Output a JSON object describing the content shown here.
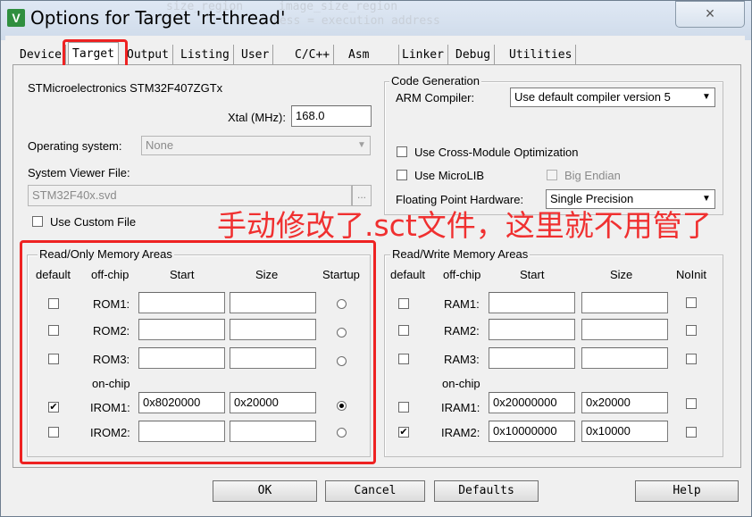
{
  "window": {
    "title": "Options for Target 'rt-thread'",
    "close_label": "×",
    "background_code": [
      "  size_region",
      "image_size_region",
      "ress = execution address"
    ]
  },
  "tabs": [
    "Device",
    "Target",
    "Output",
    "Listing",
    "User",
    "C/C++",
    "Asm",
    "Linker",
    "Debug",
    "Utilities"
  ],
  "active_tab": "Target",
  "target": {
    "device_name": "STMicroelectronics STM32F407ZGTx",
    "xtal_label": "Xtal (MHz):",
    "xtal_value": "168.0",
    "os_label": "Operating system:",
    "os_value": "None",
    "sysviewer_label": "System Viewer File:",
    "sysviewer_value": "STM32F40x.svd",
    "browse_label": "...",
    "custom_file_label": "Use Custom File"
  },
  "code_generation": {
    "title": "Code Generation",
    "compiler_label": "ARM Compiler:",
    "compiler_value": "Use default compiler version 5",
    "cross_module_label": "Use Cross-Module Optimization",
    "microlib_label": "Use MicroLIB",
    "big_endian_label": "Big Endian",
    "fpu_label": "Floating Point Hardware:",
    "fpu_value": "Single Precision"
  },
  "annotation": "手动修改了.sct文件，这里就不用管了",
  "rom": {
    "title": "Read/Only Memory Areas",
    "headers": {
      "default": "default",
      "offchip": "off-chip",
      "start": "Start",
      "size": "Size",
      "startup": "Startup"
    },
    "onchip_label": "on-chip",
    "rows": [
      {
        "name": "ROM1:",
        "start": "",
        "size": "",
        "default": false,
        "startup": false
      },
      {
        "name": "ROM2:",
        "start": "",
        "size": "",
        "default": false,
        "startup": false
      },
      {
        "name": "ROM3:",
        "start": "",
        "size": "",
        "default": false,
        "startup": false
      },
      {
        "name": "IROM1:",
        "start": "0x8020000",
        "size": "0x20000",
        "default": true,
        "startup": true
      },
      {
        "name": "IROM2:",
        "start": "",
        "size": "",
        "default": false,
        "startup": false
      }
    ]
  },
  "ram": {
    "title": "Read/Write Memory Areas",
    "headers": {
      "default": "default",
      "offchip": "off-chip",
      "start": "Start",
      "size": "Size",
      "noinit": "NoInit"
    },
    "onchip_label": "on-chip",
    "rows": [
      {
        "name": "RAM1:",
        "start": "",
        "size": "",
        "default": false,
        "noinit": false
      },
      {
        "name": "RAM2:",
        "start": "",
        "size": "",
        "default": false,
        "noinit": false
      },
      {
        "name": "RAM3:",
        "start": "",
        "size": "",
        "default": false,
        "noinit": false
      },
      {
        "name": "IRAM1:",
        "start": "0x20000000",
        "size": "0x20000",
        "default": false,
        "noinit": false
      },
      {
        "name": "IRAM2:",
        "start": "0x10000000",
        "size": "0x10000",
        "default": true,
        "noinit": false
      }
    ]
  },
  "buttons": {
    "ok": "OK",
    "cancel": "Cancel",
    "defaults": "Defaults",
    "help": "Help"
  },
  "colors": {
    "annotation_red": "#f03030",
    "highlight_red": "#ee2222",
    "checkmark": "#000000"
  }
}
